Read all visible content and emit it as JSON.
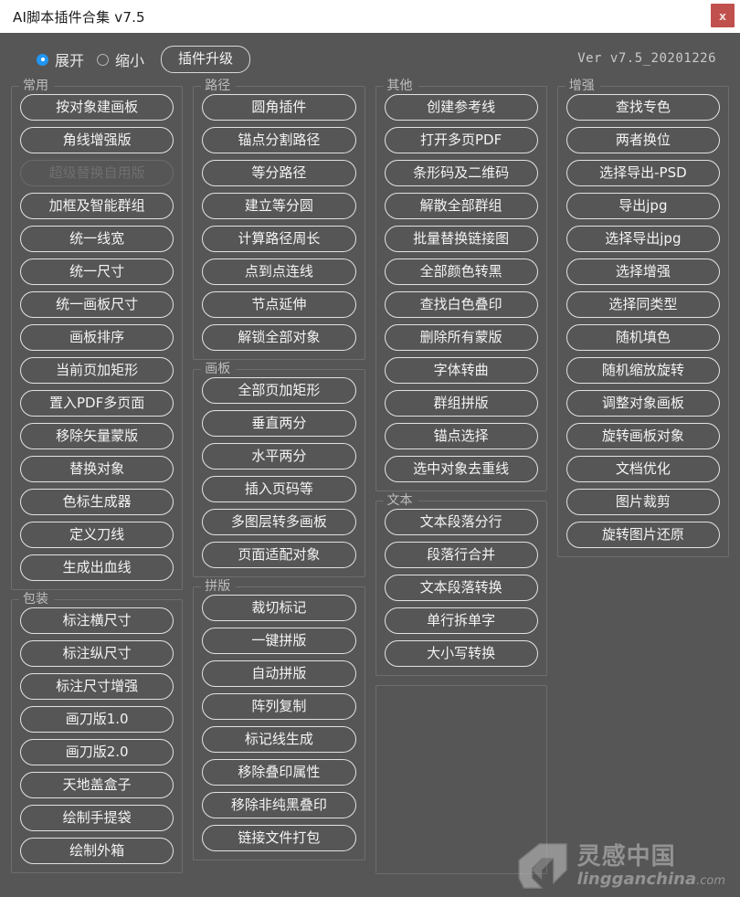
{
  "window": {
    "title": "AI脚本插件合集 v7.5",
    "close_label": "x",
    "close_color": "#c0504d"
  },
  "toolbar": {
    "radios": [
      {
        "label": "展开",
        "selected": true
      },
      {
        "label": "缩小",
        "selected": false
      }
    ],
    "upgrade_label": "插件升级",
    "version": "Ver v7.5_20201226",
    "accent_color": "#2196f3"
  },
  "columns": [
    {
      "name": "column-1",
      "groups": [
        {
          "title": "常用",
          "buttons": [
            {
              "label": "按对象建画板",
              "disabled": false
            },
            {
              "label": "角线增强版",
              "disabled": false
            },
            {
              "label": "超级替换自用版",
              "disabled": true
            },
            {
              "label": "加框及智能群组",
              "disabled": false
            },
            {
              "label": "统一线宽",
              "disabled": false
            },
            {
              "label": "统一尺寸",
              "disabled": false
            },
            {
              "label": "统一画板尺寸",
              "disabled": false
            },
            {
              "label": "画板排序",
              "disabled": false
            },
            {
              "label": "当前页加矩形",
              "disabled": false
            },
            {
              "label": "置入PDF多页面",
              "disabled": false
            },
            {
              "label": "移除矢量蒙版",
              "disabled": false
            },
            {
              "label": "替换对象",
              "disabled": false
            },
            {
              "label": "色标生成器",
              "disabled": false
            },
            {
              "label": "定义刀线",
              "disabled": false
            },
            {
              "label": "生成出血线",
              "disabled": false
            }
          ]
        },
        {
          "title": "包装",
          "buttons": [
            {
              "label": "标注横尺寸",
              "disabled": false
            },
            {
              "label": "标注纵尺寸",
              "disabled": false
            },
            {
              "label": "标注尺寸增强",
              "disabled": false
            },
            {
              "label": "画刀版1.0",
              "disabled": false
            },
            {
              "label": "画刀版2.0",
              "disabled": false
            },
            {
              "label": "天地盖盒子",
              "disabled": false
            },
            {
              "label": "绘制手提袋",
              "disabled": false
            },
            {
              "label": "绘制外箱",
              "disabled": false
            }
          ]
        }
      ]
    },
    {
      "name": "column-2",
      "groups": [
        {
          "title": "路径",
          "buttons": [
            {
              "label": "圆角插件",
              "disabled": false
            },
            {
              "label": "锚点分割路径",
              "disabled": false
            },
            {
              "label": "等分路径",
              "disabled": false
            },
            {
              "label": "建立等分圆",
              "disabled": false
            },
            {
              "label": "计算路径周长",
              "disabled": false
            },
            {
              "label": "点到点连线",
              "disabled": false
            },
            {
              "label": "节点延伸",
              "disabled": false
            },
            {
              "label": "解锁全部对象",
              "disabled": false
            }
          ]
        },
        {
          "title": "画板",
          "buttons": [
            {
              "label": "全部页加矩形",
              "disabled": false
            },
            {
              "label": "垂直两分",
              "disabled": false
            },
            {
              "label": "水平两分",
              "disabled": false
            },
            {
              "label": "插入页码等",
              "disabled": false
            },
            {
              "label": "多图层转多画板",
              "disabled": false
            },
            {
              "label": "页面适配对象",
              "disabled": false
            }
          ]
        },
        {
          "title": "拼版",
          "buttons": [
            {
              "label": "裁切标记",
              "disabled": false
            },
            {
              "label": "一键拼版",
              "disabled": false
            },
            {
              "label": "自动拼版",
              "disabled": false
            },
            {
              "label": "阵列复制",
              "disabled": false
            },
            {
              "label": "标记线生成",
              "disabled": false
            },
            {
              "label": "移除叠印属性",
              "disabled": false
            },
            {
              "label": "移除非纯黑叠印",
              "disabled": false
            },
            {
              "label": "链接文件打包",
              "disabled": false
            }
          ]
        }
      ]
    },
    {
      "name": "column-3",
      "groups": [
        {
          "title": "其他",
          "buttons": [
            {
              "label": "创建参考线",
              "disabled": false
            },
            {
              "label": "打开多页PDF",
              "disabled": false
            },
            {
              "label": "条形码及二维码",
              "disabled": false
            },
            {
              "label": "解散全部群组",
              "disabled": false
            },
            {
              "label": "批量替换链接图",
              "disabled": false
            },
            {
              "label": "全部颜色转黑",
              "disabled": false
            },
            {
              "label": "查找白色叠印",
              "disabled": false
            },
            {
              "label": "删除所有蒙版",
              "disabled": false
            },
            {
              "label": "字体转曲",
              "disabled": false
            },
            {
              "label": "群组拼版",
              "disabled": false
            },
            {
              "label": "锚点选择",
              "disabled": false
            },
            {
              "label": "选中对象去重线",
              "disabled": false
            }
          ]
        },
        {
          "title": "文本",
          "buttons": [
            {
              "label": "文本段落分行",
              "disabled": false
            },
            {
              "label": "段落行合并",
              "disabled": false
            },
            {
              "label": "文本段落转换",
              "disabled": false
            },
            {
              "label": "单行拆单字",
              "disabled": false
            },
            {
              "label": "大小写转换",
              "disabled": false
            }
          ]
        },
        {
          "title": "",
          "buttons": []
        }
      ]
    },
    {
      "name": "column-4",
      "groups": [
        {
          "title": "增强",
          "buttons": [
            {
              "label": "查找专色",
              "disabled": false
            },
            {
              "label": "两者换位",
              "disabled": false
            },
            {
              "label": "选择导出-PSD",
              "disabled": false
            },
            {
              "label": "导出jpg",
              "disabled": false
            },
            {
              "label": "选择导出jpg",
              "disabled": false
            },
            {
              "label": "选择增强",
              "disabled": false
            },
            {
              "label": "选择同类型",
              "disabled": false
            },
            {
              "label": "随机填色",
              "disabled": false
            },
            {
              "label": "随机缩放旋转",
              "disabled": false
            },
            {
              "label": "调整对象画板",
              "disabled": false
            },
            {
              "label": "旋转画板对象",
              "disabled": false
            },
            {
              "label": "文档优化",
              "disabled": false
            },
            {
              "label": "图片裁剪",
              "disabled": false
            },
            {
              "label": "旋转图片还原",
              "disabled": false
            }
          ]
        }
      ]
    }
  ],
  "watermark": {
    "cn": "灵感中国",
    "en": "lingganchina",
    "domain": ".com"
  }
}
